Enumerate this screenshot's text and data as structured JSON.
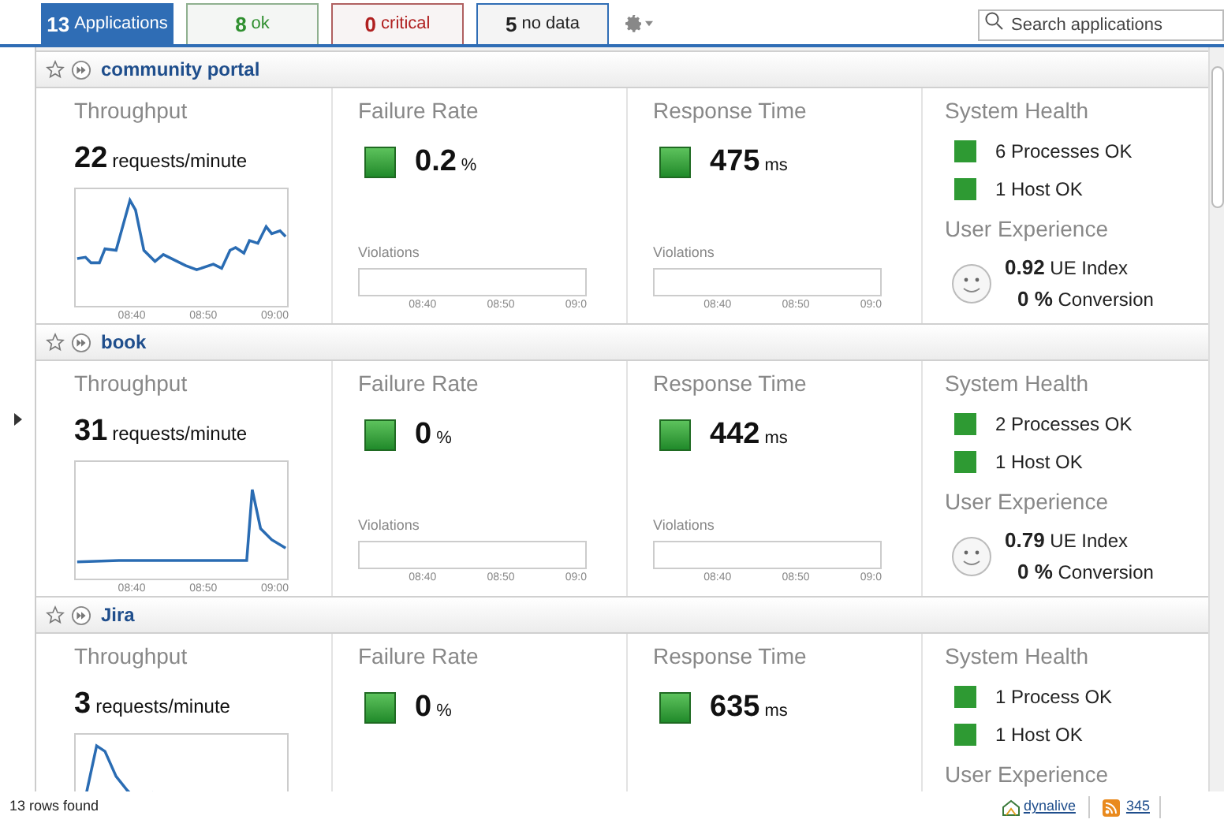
{
  "tabs": [
    {
      "count": "13",
      "label": "Applications",
      "kind": "all",
      "selected": true
    },
    {
      "count": "8",
      "label": "ok",
      "kind": "ok",
      "selected": false
    },
    {
      "count": "0",
      "label": "critical",
      "kind": "critical",
      "selected": false
    },
    {
      "count": "5",
      "label": "no data",
      "kind": "nodata",
      "selected": false
    }
  ],
  "search": {
    "placeholder": "Search applications"
  },
  "applications": [
    {
      "name": "community portal",
      "throughput": {
        "title": "Throughput",
        "value": "22",
        "unit": "requests/minute",
        "time_labels": [
          "08:40",
          "08:50",
          "09:00"
        ]
      },
      "failure_rate": {
        "title": "Failure Rate",
        "value": "0.2",
        "unit": "%",
        "violations": {
          "title": "Violations",
          "time_labels": [
            "08:40",
            "08:50",
            "09:0"
          ]
        }
      },
      "response_time": {
        "title": "Response Time",
        "value": "475",
        "unit": "ms",
        "violations": {
          "title": "Violations",
          "time_labels": [
            "08:40",
            "08:50",
            "09:0"
          ]
        }
      },
      "system_health": {
        "title": "System Health",
        "items": [
          {
            "label": "6 Processes OK",
            "color": "#2e9a33"
          },
          {
            "label": "1 Host OK",
            "color": "#2e9a33"
          }
        ]
      },
      "user_experience": {
        "title": "User Experience",
        "index": "0.92",
        "index_label": "UE Index",
        "conversion": "0 %",
        "conversion_label": "Conversion"
      }
    },
    {
      "name": "book",
      "throughput": {
        "title": "Throughput",
        "value": "31",
        "unit": "requests/minute",
        "time_labels": [
          "08:40",
          "08:50",
          "09:00"
        ]
      },
      "failure_rate": {
        "title": "Failure Rate",
        "value": "0",
        "unit": "%",
        "violations": {
          "title": "Violations",
          "time_labels": [
            "08:40",
            "08:50",
            "09:0"
          ]
        }
      },
      "response_time": {
        "title": "Response Time",
        "value": "442",
        "unit": "ms",
        "violations": {
          "title": "Violations",
          "time_labels": [
            "08:40",
            "08:50",
            "09:0"
          ]
        }
      },
      "system_health": {
        "title": "System Health",
        "items": [
          {
            "label": "2 Processes OK",
            "color": "#2e9a33"
          },
          {
            "label": "1 Host OK",
            "color": "#2e9a33"
          }
        ]
      },
      "user_experience": {
        "title": "User Experience",
        "index": "0.79",
        "index_label": "UE Index",
        "conversion": "0 %",
        "conversion_label": "Conversion"
      }
    },
    {
      "name": "Jira",
      "throughput": {
        "title": "Throughput",
        "value": "3",
        "unit": "requests/minute"
      },
      "failure_rate": {
        "title": "Failure Rate",
        "value": "0",
        "unit": "%"
      },
      "response_time": {
        "title": "Response Time",
        "value": "635",
        "unit": "ms"
      },
      "system_health": {
        "title": "System Health",
        "items": [
          {
            "label": "1 Process OK",
            "color": "#2e9a33"
          },
          {
            "label": "1 Host OK",
            "color": "#2e9a33"
          }
        ]
      },
      "user_experience": {
        "title": "User Experience"
      }
    }
  ],
  "status_bar": {
    "text": "13 rows found",
    "server_link": "dynalive",
    "feed_count": "345"
  }
}
